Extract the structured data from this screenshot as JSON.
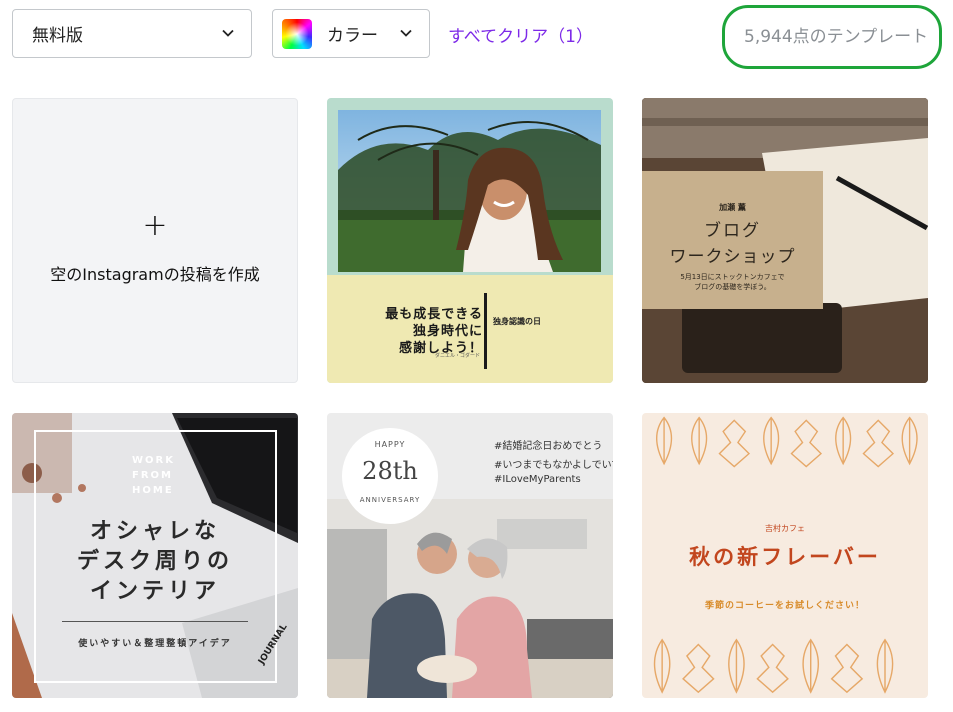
{
  "filters": {
    "plan_label": "無料版",
    "color_label": "カラー",
    "clear_all_label": "すべてクリア（1）",
    "result_count": "5,944点のテンプレート"
  },
  "colors": {
    "accent_purple": "#7d2ae8",
    "highlight_green": "#1ea53a"
  },
  "templates": {
    "blank": {
      "plus": "+",
      "label": "空のInstagramの投稿を作成"
    },
    "woman": {
      "headline_1": "最も成長できる",
      "headline_2": "独身時代に",
      "headline_3": "感謝しよう！",
      "tag": "独身認識の日",
      "signature": "ダニエル・ゴダード"
    },
    "blog": {
      "byline": "加瀬 薫",
      "title_1": "ブログ",
      "title_2": "ワークショップ",
      "desc_1": "5月13日にストックトンカフェで",
      "desc_2": "ブログの基礎を学ぼう。"
    },
    "desk": {
      "wfh_1": "WORK",
      "wfh_2": "FROM",
      "wfh_3": "HOME",
      "big_1": "オシャレな",
      "big_2": "デスク周りの",
      "big_3": "インテリア",
      "sub": "使いやすい＆整理整頓アイデア",
      "journal": "JOURNAL"
    },
    "anniversary": {
      "happy": "HAPPY",
      "number": "28th",
      "anniversary": "ANNIVERSARY",
      "hashtag_1": "#結婚記念日おめでとう",
      "hashtag_2": "#いつまでもなかよしでいてね",
      "hashtag_3": "#ILoveMyParents"
    },
    "autumn": {
      "shop": "吉村カフェ",
      "title": "秋の新フレーバー",
      "sub": "季節のコーヒーをお試しください！"
    }
  }
}
